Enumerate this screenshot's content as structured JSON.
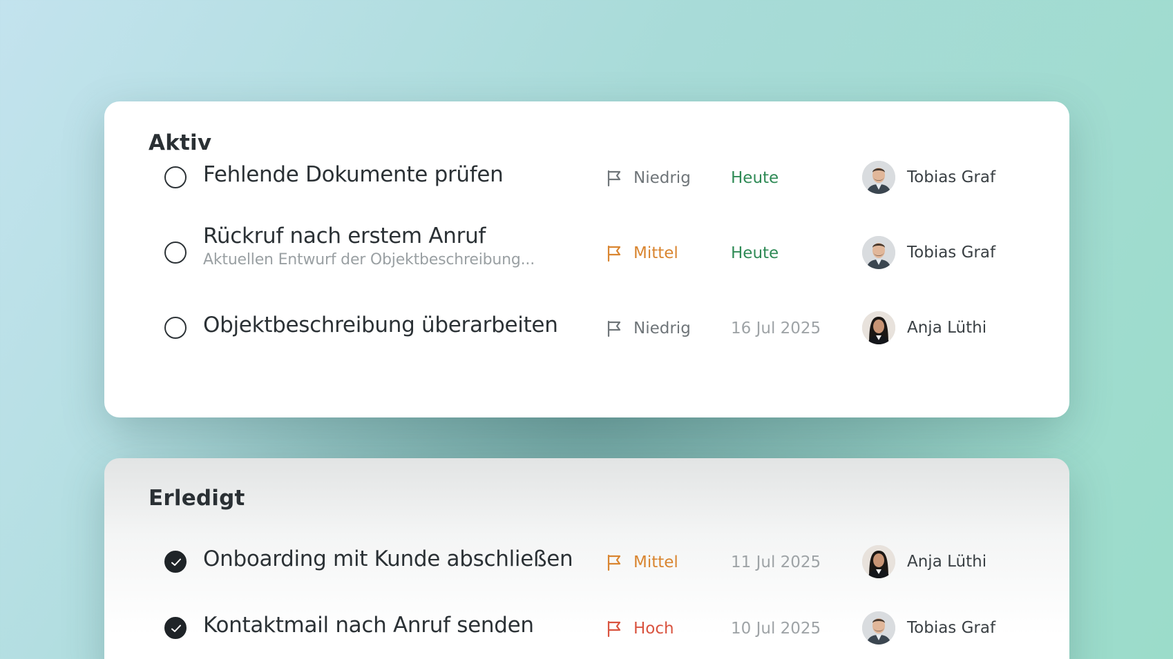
{
  "colors": {
    "priority_low": "#6f7579",
    "priority_medium": "#d98530",
    "priority_high": "#d9533f",
    "due_today": "#2e8a55",
    "due_date": "#9ea3a6"
  },
  "active": {
    "title": "Aktiv",
    "tasks": [
      {
        "title": "Fehlende Dokumente prüfen",
        "subtitle": "",
        "priority": "Niedrig",
        "priority_level": "low",
        "due": "Heute",
        "due_kind": "today",
        "assignee": "Tobias Graf",
        "avatar": "avatar-man-icon",
        "done": false
      },
      {
        "title": "Rückruf nach erstem Anruf",
        "subtitle": "Aktuellen Entwurf der Objektbeschreibung...",
        "priority": "Mittel",
        "priority_level": "medium",
        "due": "Heute",
        "due_kind": "today",
        "assignee": "Tobias Graf",
        "avatar": "avatar-man-icon",
        "done": false
      },
      {
        "title": "Objektbeschreibung überarbeiten",
        "subtitle": "",
        "priority": "Niedrig",
        "priority_level": "low",
        "due": "16 Jul 2025",
        "due_kind": "date",
        "assignee": "Anja Lüthi",
        "avatar": "avatar-woman-icon",
        "done": false
      }
    ]
  },
  "done": {
    "title": "Erledigt",
    "tasks": [
      {
        "title": "Onboarding mit Kunde abschließen",
        "subtitle": "",
        "priority": "Mittel",
        "priority_level": "medium",
        "due": "11 Jul 2025",
        "due_kind": "date",
        "assignee": "Anja Lüthi",
        "avatar": "avatar-woman-icon",
        "done": true
      },
      {
        "title": "Kontaktmail nach Anruf senden",
        "subtitle": "",
        "priority": "Hoch",
        "priority_level": "high",
        "due": "10 Jul 2025",
        "due_kind": "date",
        "assignee": "Tobias Graf",
        "avatar": "avatar-man-icon",
        "done": true
      }
    ]
  }
}
